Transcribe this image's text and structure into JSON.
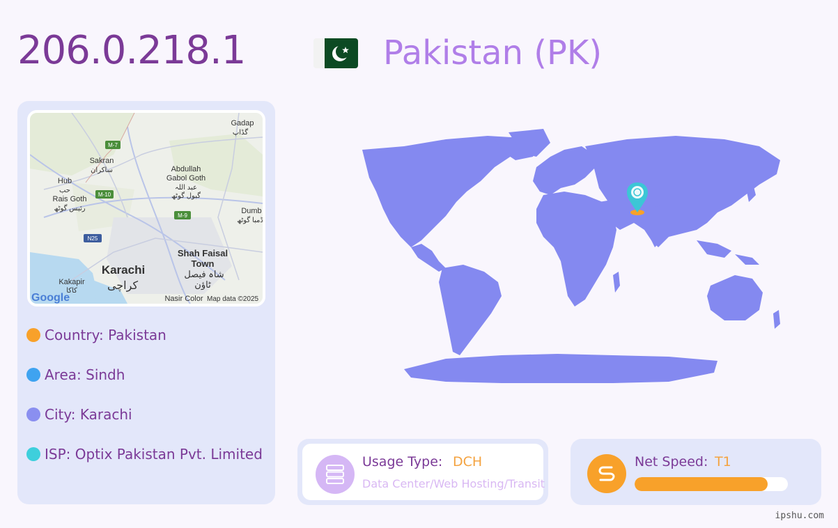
{
  "ip": "206.0.218.1",
  "country_title": "Pakistan (PK)",
  "map": {
    "labels": {
      "gadap": "Gadap",
      "gadap_ur": "گڈاپ",
      "m7": "M-7",
      "sakran": "Sakran",
      "sakran_ur": "ساکران",
      "abdullah": "Abdullah",
      "gabol": "Gabol Goth",
      "abdullah_ur": "عبد اللہ",
      "gabol_ur": "گبول گوٹھ",
      "hub": "Hub",
      "hub_ur": "حب",
      "m10": "M-10",
      "rais": "Rais Goth",
      "rais_ur": "رئیس گوٹھ",
      "m9": "M-9",
      "dumb": "Dumb",
      "dumb_ur": "ڈمبا گوٹھ",
      "n25": "N25",
      "shah": "Shah Faisal",
      "town": "Town",
      "shah_ur": "شاہ فیصل",
      "town_ur": "ٹاؤن",
      "karachi": "Karachi",
      "karachi_ur": "کراچی",
      "kakapir": "Kakapir",
      "kakapir_ur": "کاکا",
      "nasir": "Nasir Color",
      "google": "Google",
      "mapdata": "Map data ©2025"
    }
  },
  "info": {
    "country": "Country: Pakistan",
    "area": "Area: Sindh",
    "city": "City: Karachi",
    "isp": "ISP: Optix Pakistan Pvt. Limited"
  },
  "usage": {
    "label": "Usage Type:",
    "value": "DCH",
    "desc": "Data Center/Web Hosting/Transit"
  },
  "speed": {
    "label": "Net Speed:",
    "value": "T1",
    "fill_fraction": 0.87
  },
  "footer": "ipshu.com",
  "colors": {
    "country_dot": "#f8a12a",
    "area_dot": "#3fa3f0",
    "city_dot": "#8a8ff0",
    "isp_dot": "#3ecfdc",
    "land": "#8489f0",
    "marker": "#3cc6d6"
  }
}
